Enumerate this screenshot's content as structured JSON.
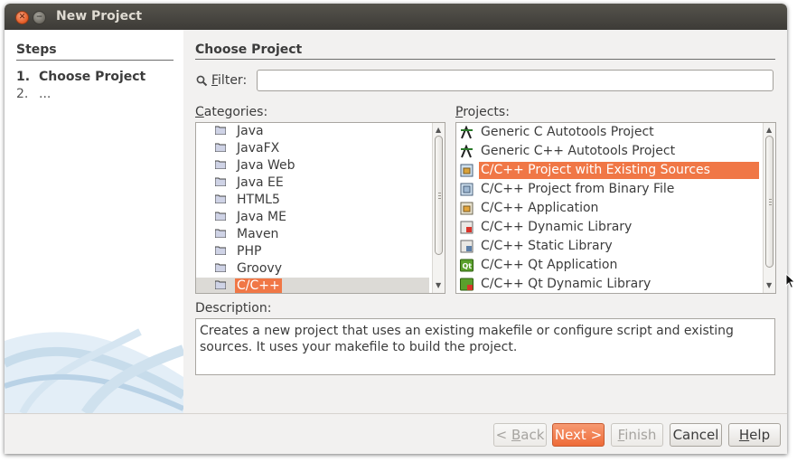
{
  "window": {
    "title": "New Project"
  },
  "steps": {
    "heading": "Steps",
    "items": [
      {
        "num": "1.",
        "label": "Choose Project"
      },
      {
        "num": "2.",
        "label": "..."
      }
    ]
  },
  "main": {
    "title": "Choose Project",
    "filter": {
      "label_u": "F",
      "label_rest": "ilter:",
      "value": ""
    },
    "categories": {
      "label_u": "C",
      "label_rest": "ategories:",
      "items": [
        "Java",
        "JavaFX",
        "Java Web",
        "Java EE",
        "HTML5",
        "Java ME",
        "Maven",
        "PHP",
        "Groovy",
        "C/C++"
      ],
      "selected": "C/C++"
    },
    "projects": {
      "label_u": "P",
      "label_rest": "rojects:",
      "items": [
        {
          "label": "Generic C Autotools Project",
          "icon": "autotools-icon"
        },
        {
          "label": "Generic C++ Autotools Project",
          "icon": "autotools-icon"
        },
        {
          "label": "C/C++ Project with Existing Sources",
          "icon": "existing-sources-icon"
        },
        {
          "label": "C/C++ Project from Binary File",
          "icon": "binary-file-icon"
        },
        {
          "label": "C/C++ Application",
          "icon": "application-icon"
        },
        {
          "label": "C/C++ Dynamic Library",
          "icon": "dynamic-library-icon"
        },
        {
          "label": "C/C++ Static Library",
          "icon": "static-library-icon"
        },
        {
          "label": "C/C++ Qt Application",
          "icon": "qt-application-icon"
        },
        {
          "label": "C/C++ Qt Dynamic Library",
          "icon": "qt-dynamic-library-icon"
        }
      ],
      "selected": "C/C++ Project with Existing Sources"
    },
    "description": {
      "label": "Description:",
      "text": "Creates a new project that uses an existing makefile or configure script and existing sources. It uses your makefile to build the project."
    }
  },
  "buttons": {
    "back": {
      "pre": "< ",
      "u": "B",
      "post": "ack"
    },
    "next": {
      "label": "Next >"
    },
    "finish": {
      "u": "F",
      "post": "inish"
    },
    "cancel": {
      "label": "Cancel"
    },
    "help": {
      "u": "H",
      "post": "elp"
    }
  },
  "colors": {
    "accent": "#f07746",
    "titlebar": "#3d3b37",
    "selection_row": "#dcdad6"
  }
}
